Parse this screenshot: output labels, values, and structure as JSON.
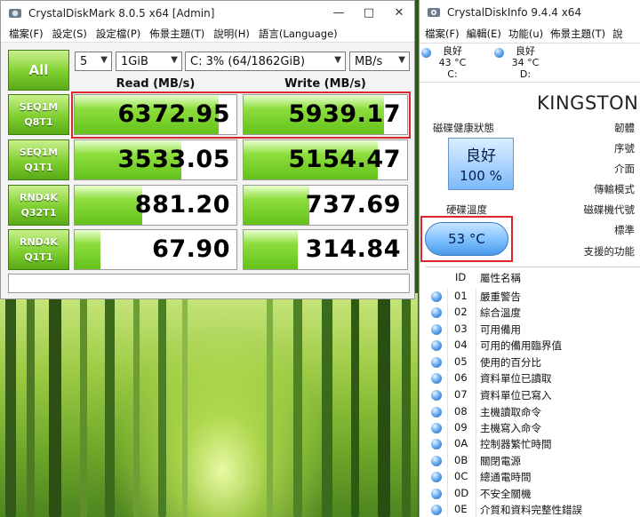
{
  "cdm": {
    "title": "CrystalDiskMark 8.0.5 x64 [Admin]",
    "menu": [
      "檔案(F)",
      "設定(S)",
      "設定檔(P)",
      "佈景主題(T)",
      "說明(H)",
      "語言(Language)"
    ],
    "all_label": "All",
    "count": "5",
    "size": "1GiB",
    "drive": "C: 3% (64/1862GiB)",
    "unit": "MB/s",
    "read_header": "Read (MB/s)",
    "write_header": "Write (MB/s)",
    "tests": [
      {
        "l1": "SEQ1M",
        "l2": "Q8T1",
        "read": "6372.95",
        "write": "5939.17",
        "read_level": 0.89,
        "write_level": 0.86
      },
      {
        "l1": "SEQ1M",
        "l2": "Q1T1",
        "read": "3533.05",
        "write": "5154.47",
        "read_level": 0.66,
        "write_level": 0.82
      },
      {
        "l1": "RND4K",
        "l2": "Q32T1",
        "read": "881.20",
        "write": "737.69",
        "read_level": 0.42,
        "write_level": 0.4
      },
      {
        "l1": "RND4K",
        "l2": "Q1T1",
        "read": "67.90",
        "write": "314.84",
        "read_level": 0.16,
        "write_level": 0.33
      }
    ],
    "comment": ""
  },
  "cdi": {
    "title": "CrystalDiskInfo 9.4.4 x64",
    "menu": [
      "檔案(F)",
      "編輯(E)",
      "功能(u)",
      "佈景主題(T)",
      "說"
    ],
    "drives": [
      {
        "status": "良好",
        "temp": "43 °C",
        "letter": "C:"
      },
      {
        "status": "良好",
        "temp": "34 °C",
        "letter": "D:"
      }
    ],
    "model": "KINGSTON",
    "health_label": "磁碟健康狀態",
    "health_status": "良好",
    "health_percent": "100 %",
    "temp_label": "硬碟溫度",
    "temp_value": "53 °C",
    "right_labels": [
      "韌體",
      "序號",
      "介面",
      "傳輸模式",
      "磁碟機代號",
      "標準",
      "支援的功能"
    ],
    "table_header": {
      "id": "ID",
      "name": "屬性名稱"
    },
    "attributes": [
      {
        "id": "01",
        "name": "嚴重警告"
      },
      {
        "id": "02",
        "name": "綜合溫度"
      },
      {
        "id": "03",
        "name": "可用備用"
      },
      {
        "id": "04",
        "name": "可用的備用臨界值"
      },
      {
        "id": "05",
        "name": "使用的百分比"
      },
      {
        "id": "06",
        "name": "資料單位已讀取"
      },
      {
        "id": "07",
        "name": "資料單位已寫入"
      },
      {
        "id": "08",
        "name": "主機讀取命令"
      },
      {
        "id": "09",
        "name": "主機寫入命令"
      },
      {
        "id": "0A",
        "name": "控制器繁忙時間"
      },
      {
        "id": "0B",
        "name": "關閉電源"
      },
      {
        "id": "0C",
        "name": "總通電時間"
      },
      {
        "id": "0D",
        "name": "不安全關機"
      },
      {
        "id": "0E",
        "name": "介質和資料完整性錯誤"
      }
    ]
  }
}
